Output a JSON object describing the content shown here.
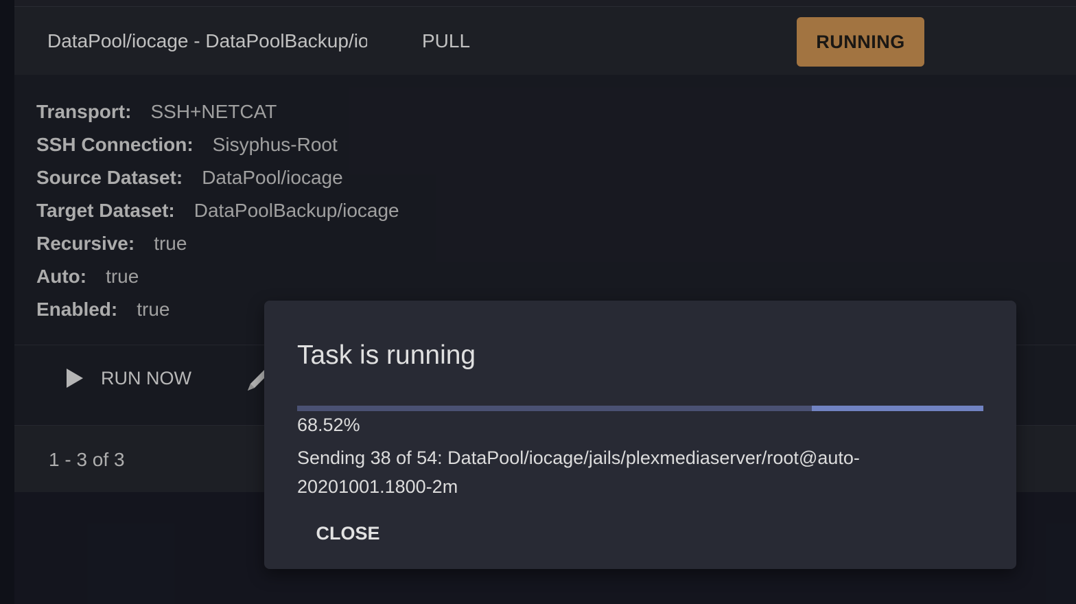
{
  "task_row": {
    "name": "DataPool/iocage - DataPoolBackup/iocage",
    "direction": "PULL",
    "state_badge": "RUNNING",
    "badge_color": "#b9844a"
  },
  "details": {
    "transport": {
      "label": "Transport:",
      "value": "SSH+NETCAT"
    },
    "ssh_connection": {
      "label": "SSH Connection:",
      "value": "Sisyphus-Root"
    },
    "source_dataset": {
      "label": "Source Dataset:",
      "value": "DataPool/iocage"
    },
    "target_dataset": {
      "label": "Target Dataset:",
      "value": "DataPoolBackup/iocage"
    },
    "recursive": {
      "label": "Recursive:",
      "value": "true"
    },
    "auto": {
      "label": "Auto:",
      "value": "true"
    },
    "enabled": {
      "label": "Enabled:",
      "value": "true"
    }
  },
  "actions": {
    "run_now_label": "RUN NOW",
    "run_now_icon": "play-icon",
    "edit_icon": "pencil-icon"
  },
  "paginator": {
    "range_text": "1 - 3 of 3"
  },
  "dialog": {
    "title": "Task is running",
    "progress_fraction": 0.75,
    "progress_text": "68.52%",
    "message": "Sending 38 of 54: DataPool/iocage/jails/plexmediaserver/root@auto-20201001.1800-2m",
    "close_label": "CLOSE",
    "progress_color": "#4a5173",
    "progress_remaining_color": "#7183c2"
  }
}
